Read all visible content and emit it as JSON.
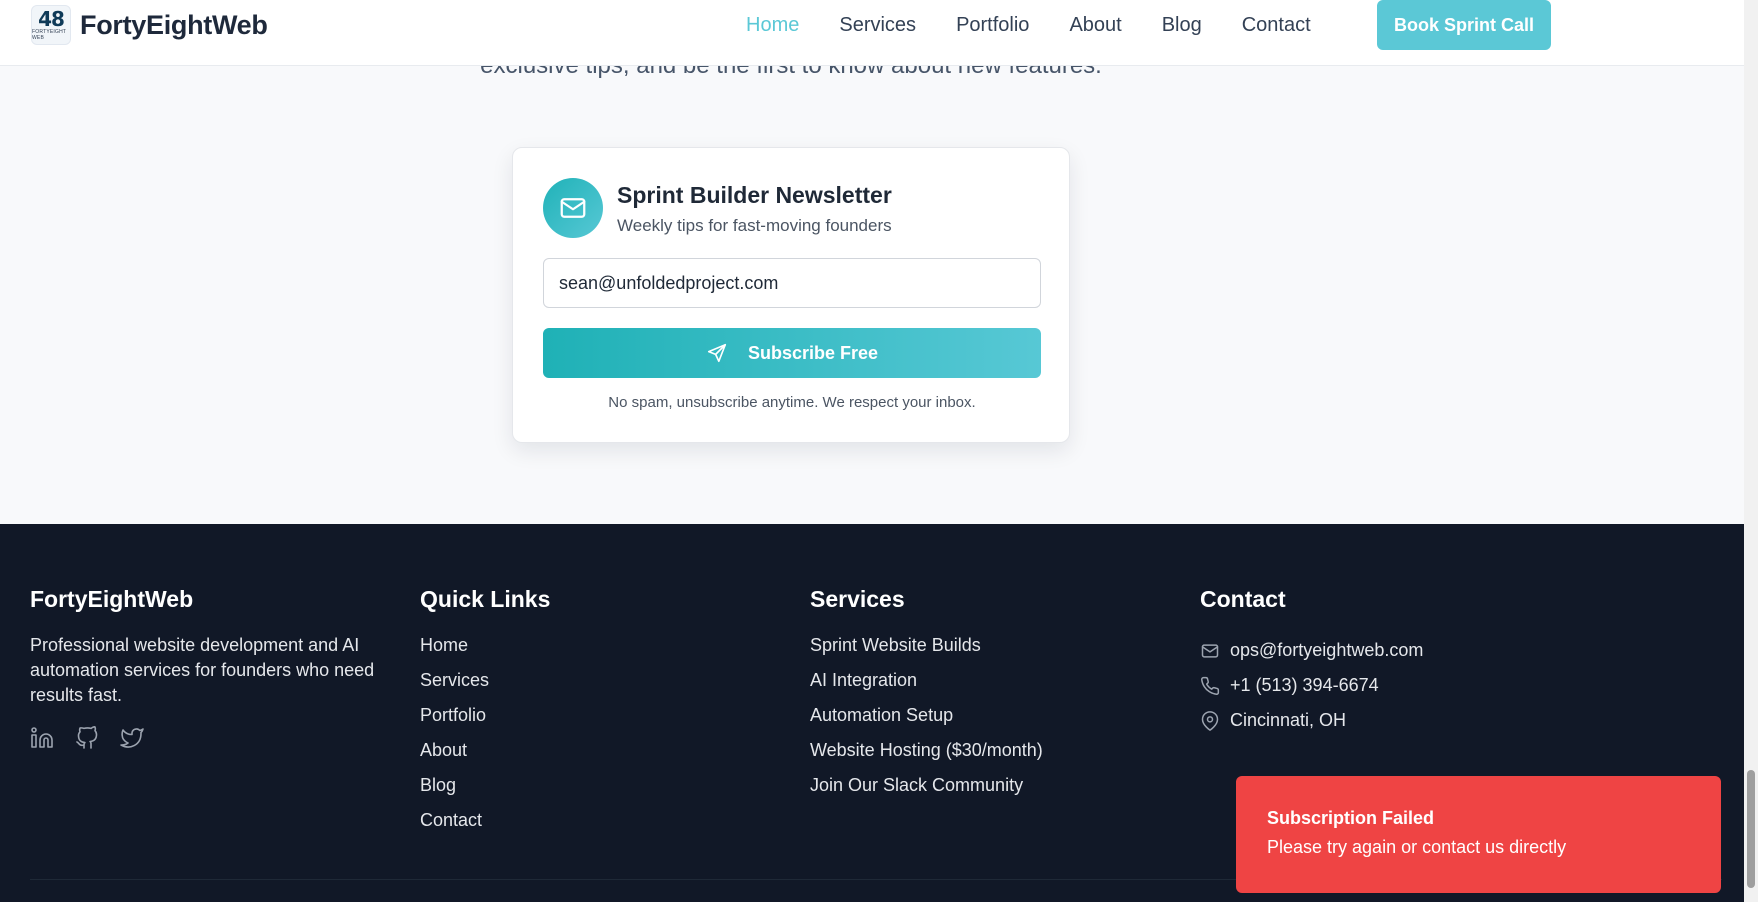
{
  "header": {
    "logo_num": "48",
    "logo_sub": "FORTYEIGHT WEB",
    "brand": "FortyEightWeb",
    "nav": [
      "Home",
      "Services",
      "Portfolio",
      "About",
      "Blog",
      "Contact"
    ],
    "active": "Home",
    "cta": "Book Sprint Call"
  },
  "intro": "exclusive tips, and be the first to know about new features.",
  "newsletter": {
    "icon": "mail-icon",
    "title": "Sprint Builder Newsletter",
    "subtitle": "Weekly tips for fast-moving founders",
    "email_value": "sean@unfoldedproject.com",
    "button": "Subscribe Free",
    "note": "No spam, unsubscribe anytime. We respect your inbox."
  },
  "footer": {
    "brand": {
      "title": "FortyEightWeb",
      "desc": "Professional website development and AI automation services for founders who need results fast.",
      "socials": [
        "linkedin-icon",
        "github-icon",
        "twitter-icon"
      ]
    },
    "quick_links": {
      "title": "Quick Links",
      "items": [
        "Home",
        "Services",
        "Portfolio",
        "About",
        "Blog",
        "Contact"
      ]
    },
    "services": {
      "title": "Services",
      "items": [
        "Sprint Website Builds",
        "AI Integration",
        "Automation Setup",
        "Website Hosting ($30/month)",
        "Join Our Slack Community"
      ]
    },
    "contact": {
      "title": "Contact",
      "email": "ops@fortyeightweb.com",
      "phone": "+1 (513) 394-6674",
      "location": "Cincinnati, OH"
    }
  },
  "toast": {
    "title": "Subscription Failed",
    "message": "Please try again or contact us directly"
  },
  "colors": {
    "accent": "#5bc8d6",
    "footer_bg": "#111827",
    "error": "#ef4444"
  }
}
